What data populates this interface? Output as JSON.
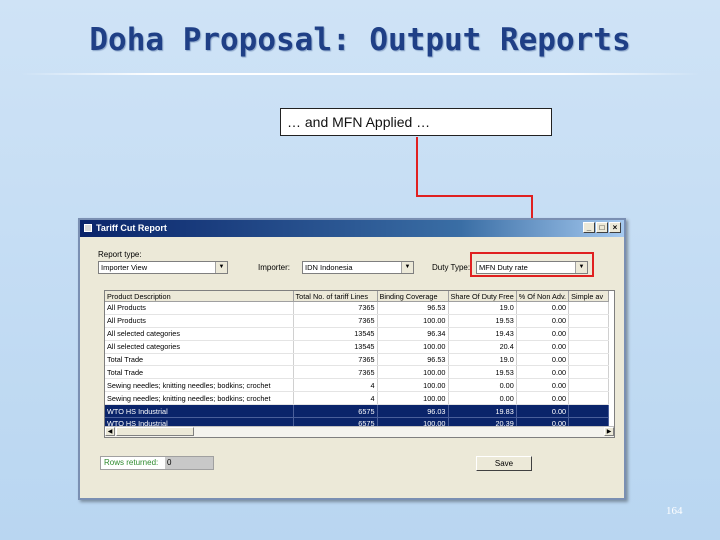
{
  "slide": {
    "title": "Doha Proposal: Output Reports",
    "callout": "… and MFN Applied …",
    "page_number": "164"
  },
  "window": {
    "title": "Tariff Cut Report",
    "controls": [
      "_",
      "□",
      "×"
    ],
    "report_type_label": "Report type:",
    "report_type_value": "Importer View",
    "importer_label": "Importer:",
    "importer_value": "IDN Indonesia",
    "duty_type_label": "Duty Type:",
    "duty_type_value": "MFN Duty rate",
    "table": {
      "headers": [
        "Product Description",
        "Total No. of tariff Lines",
        "Binding Coverage",
        "Share Of Duty Free",
        "% Of Non Adv.",
        "Simple av"
      ],
      "rows": [
        {
          "desc": "All Products",
          "lines": "7365",
          "binding": "96.53",
          "share": "19.0",
          "nonadv": "0.00",
          "simple": "",
          "selected": false
        },
        {
          "desc": "All Products",
          "lines": "7365",
          "binding": "100.00",
          "share": "19.53",
          "nonadv": "0.00",
          "simple": "",
          "selected": false
        },
        {
          "desc": "All selected categories",
          "lines": "13545",
          "binding": "96.34",
          "share": "19.43",
          "nonadv": "0.00",
          "simple": "",
          "selected": false
        },
        {
          "desc": "All selected categories",
          "lines": "13545",
          "binding": "100.00",
          "share": "20.4",
          "nonadv": "0.00",
          "simple": "",
          "selected": false
        },
        {
          "desc": "Total Trade",
          "lines": "7365",
          "binding": "96.53",
          "share": "19.0",
          "nonadv": "0.00",
          "simple": "",
          "selected": false
        },
        {
          "desc": "Total Trade",
          "lines": "7365",
          "binding": "100.00",
          "share": "19.53",
          "nonadv": "0.00",
          "simple": "",
          "selected": false
        },
        {
          "desc": "Sewing needles; knitting needles; bodkins; crochet",
          "lines": "4",
          "binding": "100.00",
          "share": "0.00",
          "nonadv": "0.00",
          "simple": "",
          "selected": false
        },
        {
          "desc": "Sewing needles; knitting needles; bodkins; crochet",
          "lines": "4",
          "binding": "100.00",
          "share": "0.00",
          "nonadv": "0.00",
          "simple": "",
          "selected": false
        },
        {
          "desc": "WTO HS Industrial",
          "lines": "6575",
          "binding": "96.03",
          "share": "19.83",
          "nonadv": "0.00",
          "simple": "",
          "selected": true
        },
        {
          "desc": "WTO HS Industrial",
          "lines": "6575",
          "binding": "100.00",
          "share": "20.39",
          "nonadv": "0.00",
          "simple": "",
          "selected": true
        }
      ]
    },
    "rows_returned_label": "Rows returned:",
    "rows_returned_value": "0",
    "save_label": "Save"
  }
}
